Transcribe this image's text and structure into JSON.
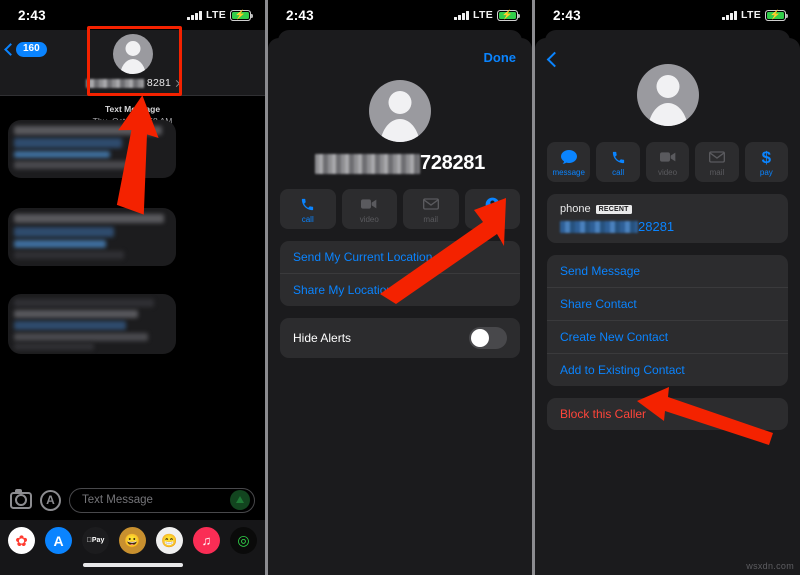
{
  "meta": {
    "watermark": "wsxdn.com"
  },
  "status_bar": {
    "time": "2:43",
    "network": "LTE",
    "battery_charging": true
  },
  "panel1": {
    "name": "messages-conversation",
    "back_badge": "160",
    "contact_number_suffix": "8281",
    "timestamp_label": "Text Message",
    "timestamp_date": "Thu, Oct 1, 11:58 AM",
    "composer": {
      "placeholder": "Text Message"
    },
    "dock_apps": [
      {
        "name": "photos-app-icon",
        "glyph": "✿"
      },
      {
        "name": "app-store-app-icon",
        "glyph": "A"
      },
      {
        "name": "apple-pay-icon",
        "glyph": "Pay"
      },
      {
        "name": "memoji-icon-1",
        "glyph": "🙂"
      },
      {
        "name": "memoji-icon-2",
        "glyph": "🙂"
      },
      {
        "name": "music-app-icon",
        "glyph": "♫"
      },
      {
        "name": "fitness-app-icon",
        "glyph": "◎"
      }
    ]
  },
  "panel2": {
    "name": "contact-details-sheet",
    "done_label": "Done",
    "contact_number_suffix": "728281",
    "actions": [
      {
        "label": "call",
        "icon": "phone-icon",
        "enabled": true
      },
      {
        "label": "video",
        "icon": "video-icon",
        "enabled": false
      },
      {
        "label": "mail",
        "icon": "mail-icon",
        "enabled": false
      },
      {
        "label": "info",
        "icon": "info-person-icon",
        "enabled": true
      }
    ],
    "location_group": [
      "Send My Current Location",
      "Share My Location"
    ],
    "hide_alerts": {
      "label": "Hide Alerts",
      "enabled": false
    }
  },
  "panel3": {
    "name": "contact-info-sheet",
    "actions": [
      {
        "label": "message",
        "icon": "message-bubble-icon",
        "enabled": true
      },
      {
        "label": "call",
        "icon": "phone-icon",
        "enabled": true
      },
      {
        "label": "video",
        "icon": "video-icon",
        "enabled": false
      },
      {
        "label": "mail",
        "icon": "mail-icon",
        "enabled": false
      },
      {
        "label": "pay",
        "icon": "dollar-icon",
        "enabled": true
      }
    ],
    "phone_field": {
      "label": "phone",
      "badge": "RECENT",
      "number_suffix": "28281"
    },
    "options": [
      "Send Message",
      "Share Contact",
      "Create New Contact",
      "Add to Existing Contact"
    ],
    "block_label": "Block this Caller"
  },
  "colors": {
    "accent_blue": "#0a84ff",
    "danger_red": "#ff453a",
    "annotation_red": "#f42200",
    "sheet_bg": "#1b1b1d",
    "row_bg": "#2c2c2e"
  }
}
